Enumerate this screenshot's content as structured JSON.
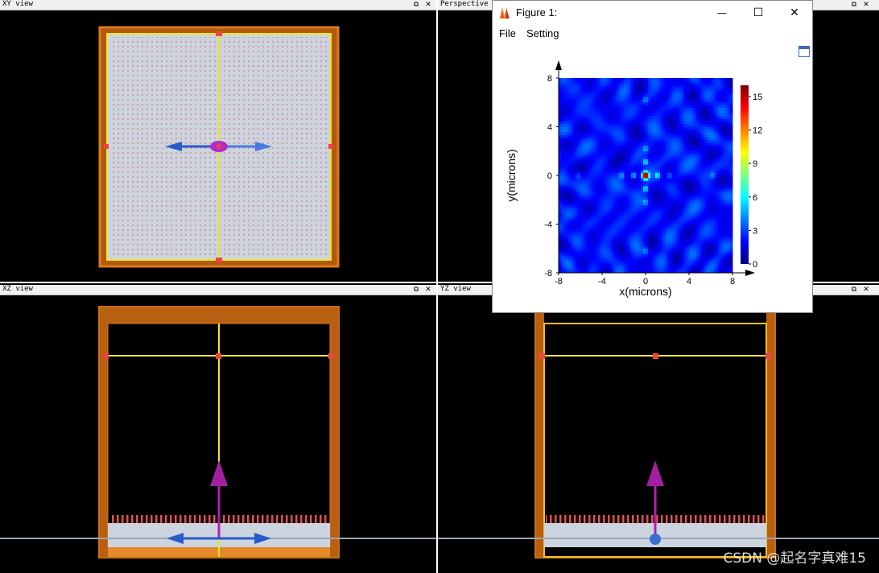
{
  "views": {
    "xy": {
      "title": "XY view",
      "restore_icon": "restore-window-icon",
      "close_icon": "close-icon"
    },
    "perspective": {
      "title": "Perspective",
      "restore_icon": "restore-window-icon",
      "close_icon": "close-icon"
    },
    "xz": {
      "title": "XZ view",
      "restore_icon": "restore-window-icon",
      "close_icon": "close-icon"
    },
    "yz": {
      "title": "YZ view",
      "restore_icon": "restore-window-icon",
      "close_icon": "close-icon"
    }
  },
  "glyphs": {
    "restore": "⧉",
    "close": "✕",
    "minimize": "—",
    "maximize": "☐"
  },
  "figure": {
    "title": "Figure 1:",
    "menu": [
      "File",
      "Setting"
    ],
    "window_buttons": [
      "minimize-icon",
      "maximize-icon",
      "close-icon"
    ]
  },
  "chart_data": {
    "type": "heatmap",
    "title": "",
    "xlabel": "x(microns)",
    "ylabel": "y(microns)",
    "xlim": [
      -8,
      8
    ],
    "ylim": [
      -8,
      8
    ],
    "x_ticks": [
      -8,
      -4,
      0,
      4,
      8
    ],
    "y_ticks": [
      8,
      4,
      0,
      -4,
      -8
    ],
    "colorbar": {
      "min": 0,
      "max": 16,
      "ticks": [
        15,
        12,
        9,
        6,
        3,
        0
      ],
      "colormap": "jet"
    },
    "peak": {
      "x": 0,
      "y": 0,
      "value": 16
    },
    "grid": false
  },
  "colors": {
    "fdtd_orange": "#c86e14",
    "sim_yellow": "#f0e628",
    "source_blue": "#3c6ed2",
    "monitor_purple": "#a020a0",
    "substrate_gray": "#c8d2dc",
    "pillar_red": "#e05050"
  },
  "watermark": "CSDN @起名字真难15"
}
